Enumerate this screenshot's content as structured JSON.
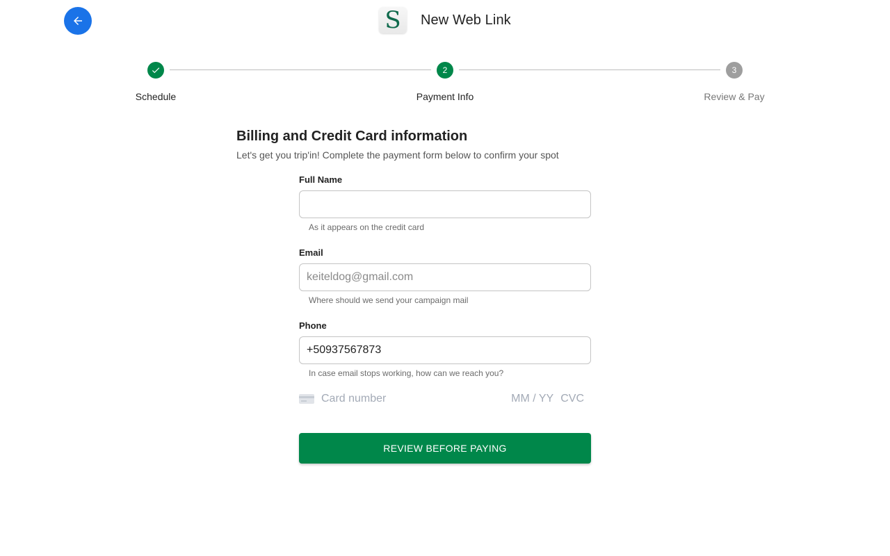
{
  "header": {
    "back_icon": "arrow-left-icon",
    "logo_letter": "S",
    "title": "New Web Link"
  },
  "stepper": {
    "steps": [
      {
        "label": "Schedule",
        "state": "completed",
        "number": "1",
        "icon": "check-icon"
      },
      {
        "label": "Payment Info",
        "state": "active",
        "number": "2"
      },
      {
        "label": "Review & Pay",
        "state": "upcoming",
        "number": "3"
      }
    ]
  },
  "form": {
    "title": "Billing and Credit Card information",
    "subtitle": "Let's get you trip'in! Complete the payment form below to confirm your spot",
    "full_name": {
      "label": "Full Name",
      "value": "",
      "helper": "As it appears on the credit card"
    },
    "email": {
      "label": "Email",
      "placeholder": "keiteldog@gmail.com",
      "value": "",
      "helper": "Where should we send your campaign mail"
    },
    "phone": {
      "label": "Phone",
      "value": "+50937567873",
      "helper": "In case email stops working, how can we reach you?"
    },
    "card": {
      "icon": "credit-card-icon",
      "number_placeholder": "Card number",
      "expiry_placeholder": "MM / YY",
      "cvc_placeholder": "CVC"
    },
    "submit_label": "REVIEW BEFORE PAYING"
  },
  "colors": {
    "back_button": "#1a73e8",
    "step_active": "#00874a",
    "step_upcoming": "#9e9e9e",
    "submit_button": "#00874a"
  }
}
